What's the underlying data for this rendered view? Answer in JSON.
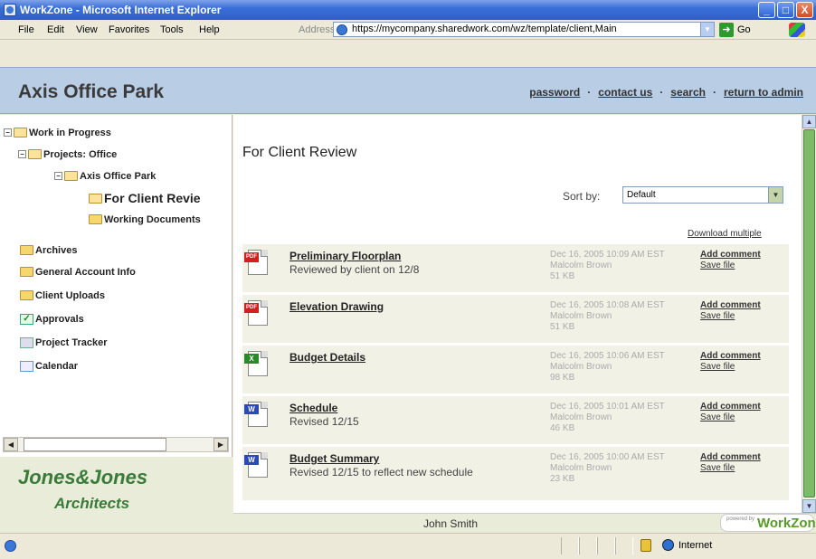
{
  "window": {
    "title": "WorkZone - Microsoft Internet Explorer",
    "buttons": {
      "minimize": "_",
      "maximize": "□",
      "close": "X"
    }
  },
  "menubar": {
    "items": [
      "File",
      "Edit",
      "View",
      "Favorites",
      "Tools",
      "Help"
    ],
    "address_label": "Address",
    "address_value": "https://mycompany.sharedwork.com/wz/template/client,Main",
    "go_label": "Go"
  },
  "header": {
    "site_title": "Axis Office Park",
    "links": [
      "password",
      "contact us",
      "search",
      "return to admin"
    ],
    "separator": "·"
  },
  "sidebar": {
    "tree": [
      {
        "label": "Work in Progress",
        "toggle": "−"
      },
      {
        "label": "Projects: Office",
        "toggle": "−"
      },
      {
        "label": "Axis Office Park",
        "toggle": "−"
      },
      {
        "label": "For Client Revie"
      },
      {
        "label": "Working Documents"
      },
      {
        "label": "Archives"
      },
      {
        "label": "General Account Info"
      },
      {
        "label": "Client Uploads"
      },
      {
        "label": "Approvals"
      },
      {
        "label": "Project Tracker"
      },
      {
        "label": "Calendar"
      }
    ],
    "logo_line1": "Jones&Jones",
    "logo_line2": "Architects"
  },
  "main": {
    "page_title": "For Client Review",
    "sort_label": "Sort by:",
    "sort_value": "Default",
    "download_multiple": "Download multiple",
    "files": [
      {
        "name": "Preliminary Floorplan",
        "desc": "Reviewed by client on 12/8",
        "date": "Dec 16, 2005 10:09 AM EST",
        "author": "Malcolm Brown",
        "size": "51 KB",
        "type": "PDF",
        "add": "Add comment",
        "save": "Save file"
      },
      {
        "name": "Elevation Drawing",
        "desc": "",
        "date": "Dec 16, 2005 10:08 AM EST",
        "author": "Malcolm Brown",
        "size": "51 KB",
        "type": "PDF",
        "add": "Add comment",
        "save": "Save file"
      },
      {
        "name": "Budget Details",
        "desc": "",
        "date": "Dec 16, 2005 10:06 AM EST",
        "author": "Malcolm Brown",
        "size": "98 KB",
        "type": "X",
        "add": "Add comment",
        "save": "Save file"
      },
      {
        "name": "Schedule",
        "desc": "Revised 12/15",
        "date": "Dec 16, 2005 10:01 AM EST",
        "author": "Malcolm Brown",
        "size": "46 KB",
        "type": "W",
        "add": "Add comment",
        "save": "Save file"
      },
      {
        "name": "Budget Summary",
        "desc": "Revised 12/15 to reflect new schedule",
        "date": "Dec 16, 2005 10:00 AM EST",
        "author": "Malcolm Brown",
        "size": "23 KB",
        "type": "W",
        "add": "Add comment",
        "save": "Save file"
      }
    ]
  },
  "footer": {
    "user": "John Smith",
    "powered_small": "powered by",
    "brand": "WorkZone"
  },
  "statusbar": {
    "zone": "Internet"
  },
  "colors": {
    "header_band": "#b9cde5",
    "logo_green": "#3a7a3a",
    "row_bg": "#f2f1e6",
    "scroll_thumb": "#7fba6a"
  }
}
